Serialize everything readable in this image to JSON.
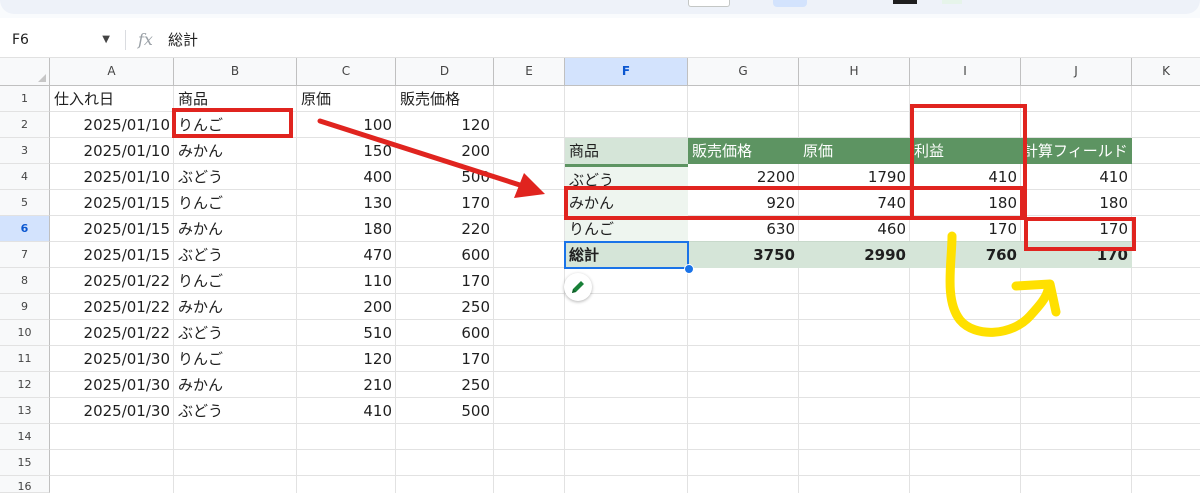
{
  "namebox": {
    "cell_ref": "F6",
    "dropdown_icon": "caret-down-icon"
  },
  "formula": {
    "fx_label": "fx",
    "content": "総計"
  },
  "columns": [
    "A",
    "B",
    "C",
    "D",
    "E",
    "F",
    "G",
    "H",
    "I",
    "J",
    "K"
  ],
  "selected_column": "F",
  "rows": [
    "1",
    "2",
    "3",
    "4",
    "5",
    "6",
    "7",
    "8",
    "9",
    "10",
    "11",
    "12",
    "13",
    "14",
    "15",
    "16"
  ],
  "selected_row": "6",
  "source_table": {
    "headers": [
      "仕入れ日",
      "商品",
      "原価",
      "販売価格"
    ],
    "data": [
      [
        "2025/01/10",
        "りんご",
        "100",
        "120"
      ],
      [
        "2025/01/10",
        "みかん",
        "150",
        "200"
      ],
      [
        "2025/01/10",
        "ぶどう",
        "400",
        "500"
      ],
      [
        "2025/01/15",
        "りんご",
        "130",
        "170"
      ],
      [
        "2025/01/15",
        "みかん",
        "180",
        "220"
      ],
      [
        "2025/01/15",
        "ぶどう",
        "470",
        "600"
      ],
      [
        "2025/01/22",
        "りんご",
        "110",
        "170"
      ],
      [
        "2025/01/22",
        "みかん",
        "200",
        "250"
      ],
      [
        "2025/01/22",
        "ぶどう",
        "510",
        "600"
      ],
      [
        "2025/01/30",
        "りんご",
        "120",
        "170"
      ],
      [
        "2025/01/30",
        "みかん",
        "210",
        "250"
      ],
      [
        "2025/01/30",
        "ぶどう",
        "410",
        "500"
      ]
    ]
  },
  "pivot_table": {
    "headers": [
      "商品",
      "販売価格",
      "原価",
      "利益",
      "計算フィールド"
    ],
    "data": [
      [
        "ぶどう",
        "2200",
        "1790",
        "410",
        "410"
      ],
      [
        "みかん",
        "920",
        "740",
        "180",
        "180"
      ],
      [
        "りんご",
        "630",
        "460",
        "170",
        "170"
      ]
    ],
    "total": [
      "総計",
      "3750",
      "2990",
      "760",
      "170"
    ]
  },
  "annotation_colors": {
    "red": "#e0241f",
    "yellow": "#ffe000"
  },
  "pivot_colors": {
    "header": "#5d9462",
    "header_first": "#d5e5d8",
    "total": "#d5e5d8"
  }
}
